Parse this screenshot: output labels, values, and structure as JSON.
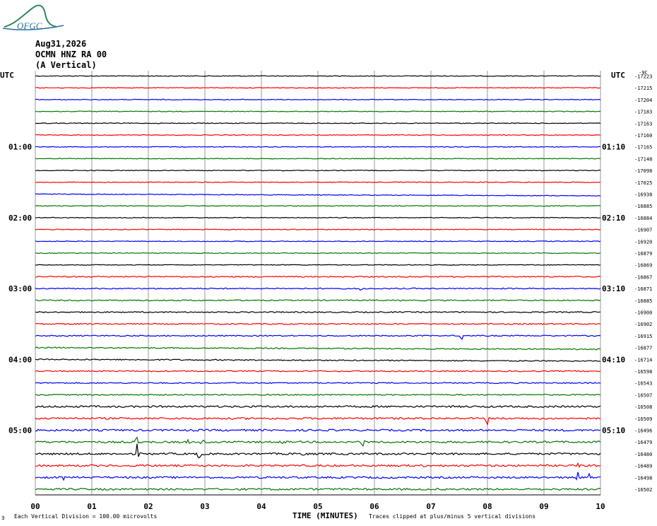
{
  "logo_text": "OFGC",
  "header": {
    "date": "Aug31,2026",
    "station": "OCMN HNZ RA 00",
    "component": "(A Vertical)"
  },
  "utc_left": "UTC",
  "utc_right": "UTC",
  "right_top_label": "-9C",
  "footer": {
    "left_mark": "∃",
    "division_note": "Each Vertical Division =  100.00 microvolts",
    "xlabel": "TIME (MINUTES)",
    "clip_note": "Traces clipped at plus/minus 5 vertical divisions"
  },
  "colors": {
    "cycle": [
      "#000000",
      "#ff0000",
      "#0000ff",
      "#007700"
    ],
    "grid": "#999999",
    "logo": "#2a6f97",
    "logo_hill": "#2e8b57"
  },
  "chart_data": {
    "type": "line",
    "title": "",
    "xlabel": "TIME (MINUTES)",
    "xlim": [
      0,
      10
    ],
    "x_ticks": [
      "00",
      "01",
      "02",
      "03",
      "04",
      "05",
      "06",
      "07",
      "08",
      "09",
      "10"
    ],
    "y_ticks_left": [
      "01:00",
      "02:00",
      "03:00",
      "04:00",
      "05:00"
    ],
    "y_ticks_right": [
      "01:10",
      "02:10",
      "03:10",
      "04:10",
      "05:10"
    ],
    "trace_offsets": [
      -17223,
      -17215,
      -17204,
      -17183,
      -17163,
      -17160,
      -17165,
      -17148,
      -17098,
      -17025,
      -16938,
      -16885,
      -16884,
      -16907,
      -16920,
      -16879,
      -16869,
      -16867,
      -16871,
      -16885,
      -16900,
      -16902,
      -16915,
      -16877,
      -16714,
      -16598,
      -16543,
      -16507,
      -16508,
      -16509,
      -16496,
      -16479,
      -16480,
      -16489,
      -16498,
      -16502
    ],
    "events": [
      {
        "trace": 18,
        "minute": 5.75,
        "amp": 6
      },
      {
        "trace": 22,
        "minute": 7.55,
        "amp": 12
      },
      {
        "trace": 29,
        "minute": 8.0,
        "amp": 10
      },
      {
        "trace": 31,
        "minute": 1.8,
        "amp": 10
      },
      {
        "trace": 31,
        "minute": 2.7,
        "amp": 6
      },
      {
        "trace": 31,
        "minute": 2.95,
        "amp": 7
      },
      {
        "trace": 31,
        "minute": 4.4,
        "amp": 5
      },
      {
        "trace": 31,
        "minute": 5.8,
        "amp": 7
      },
      {
        "trace": 32,
        "minute": 1.8,
        "amp": 14
      },
      {
        "trace": 32,
        "minute": 2.9,
        "amp": 10
      },
      {
        "trace": 32,
        "minute": 4.75,
        "amp": 5
      },
      {
        "trace": 33,
        "minute": 1.95,
        "amp": 8
      },
      {
        "trace": 33,
        "minute": 6.85,
        "amp": 6
      },
      {
        "trace": 33,
        "minute": 9.6,
        "amp": 8
      },
      {
        "trace": 34,
        "minute": 0.5,
        "amp": 6
      },
      {
        "trace": 34,
        "minute": 9.6,
        "amp": 9
      },
      {
        "trace": 34,
        "minute": 9.8,
        "amp": 7
      }
    ]
  }
}
